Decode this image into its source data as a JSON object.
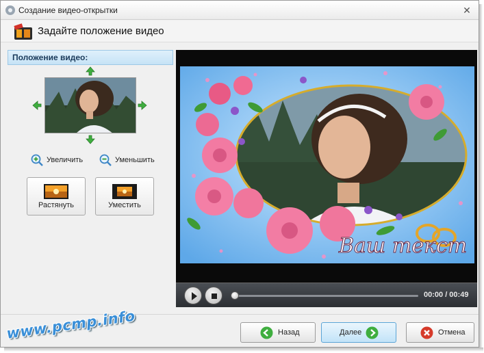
{
  "window": {
    "title": "Создание видео-открытки",
    "close_glyph": "✕"
  },
  "header": {
    "title": "Задайте положение видео"
  },
  "position_panel": {
    "title": "Положение видео:",
    "zoom_in_label": "Увеличить",
    "zoom_out_label": "Уменьшить",
    "stretch_label": "Растянуть",
    "fit_label": "Уместить"
  },
  "preview": {
    "overlay_text": "Ваш текст"
  },
  "player": {
    "time": "00:00 / 00:49",
    "progress": 0
  },
  "footer": {
    "back_label": "Назад",
    "next_label": "Далее",
    "cancel_label": "Отмена"
  },
  "watermark": {
    "text": "www.pcmp.info"
  },
  "colors": {
    "accent": "#5aa4d6",
    "back_icon": "#3fae3f",
    "next_icon": "#3fae3f",
    "cancel_icon": "#d63a2a",
    "arrow": "#3fae3f"
  }
}
